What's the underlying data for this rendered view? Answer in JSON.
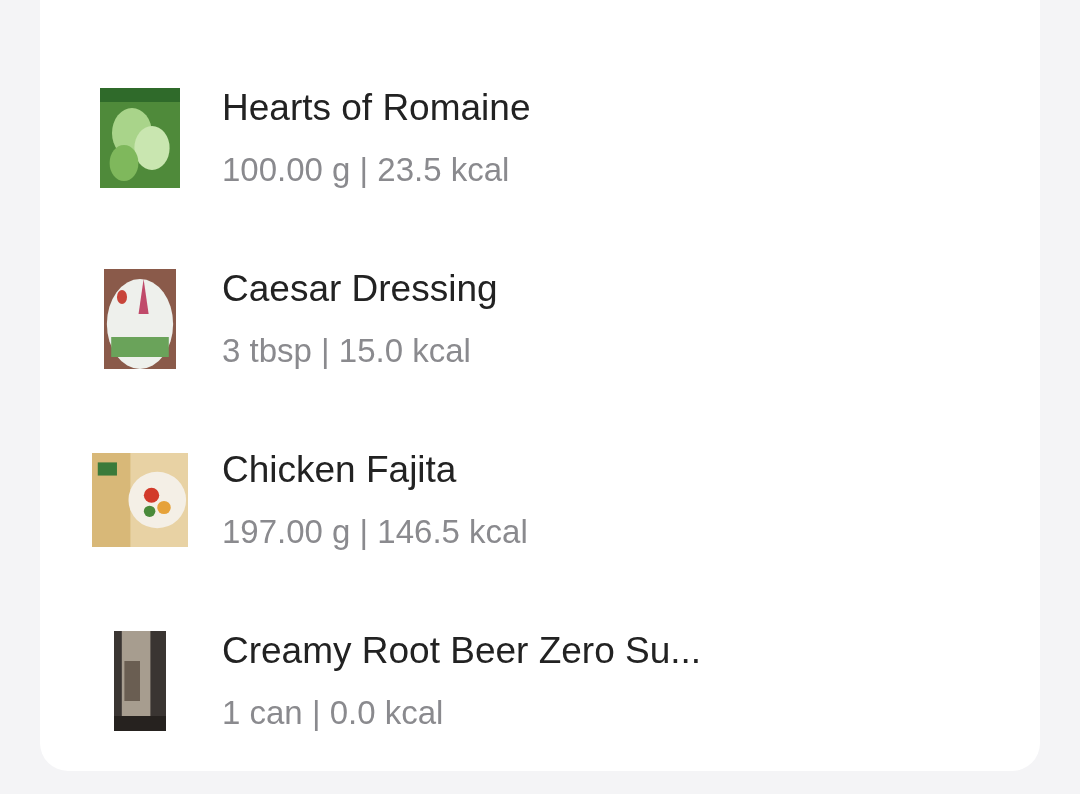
{
  "items": [
    {
      "name": "Hearts of Romaine",
      "detail": "100.00 g | 23.5 kcal"
    },
    {
      "name": "Caesar Dressing",
      "detail": "3 tbsp | 15.0 kcal"
    },
    {
      "name": "Chicken Fajita",
      "detail": "197.00 g | 146.5 kcal"
    },
    {
      "name": "Creamy Root Beer Zero Su...",
      "detail": "1 can | 0.0 kcal"
    }
  ]
}
